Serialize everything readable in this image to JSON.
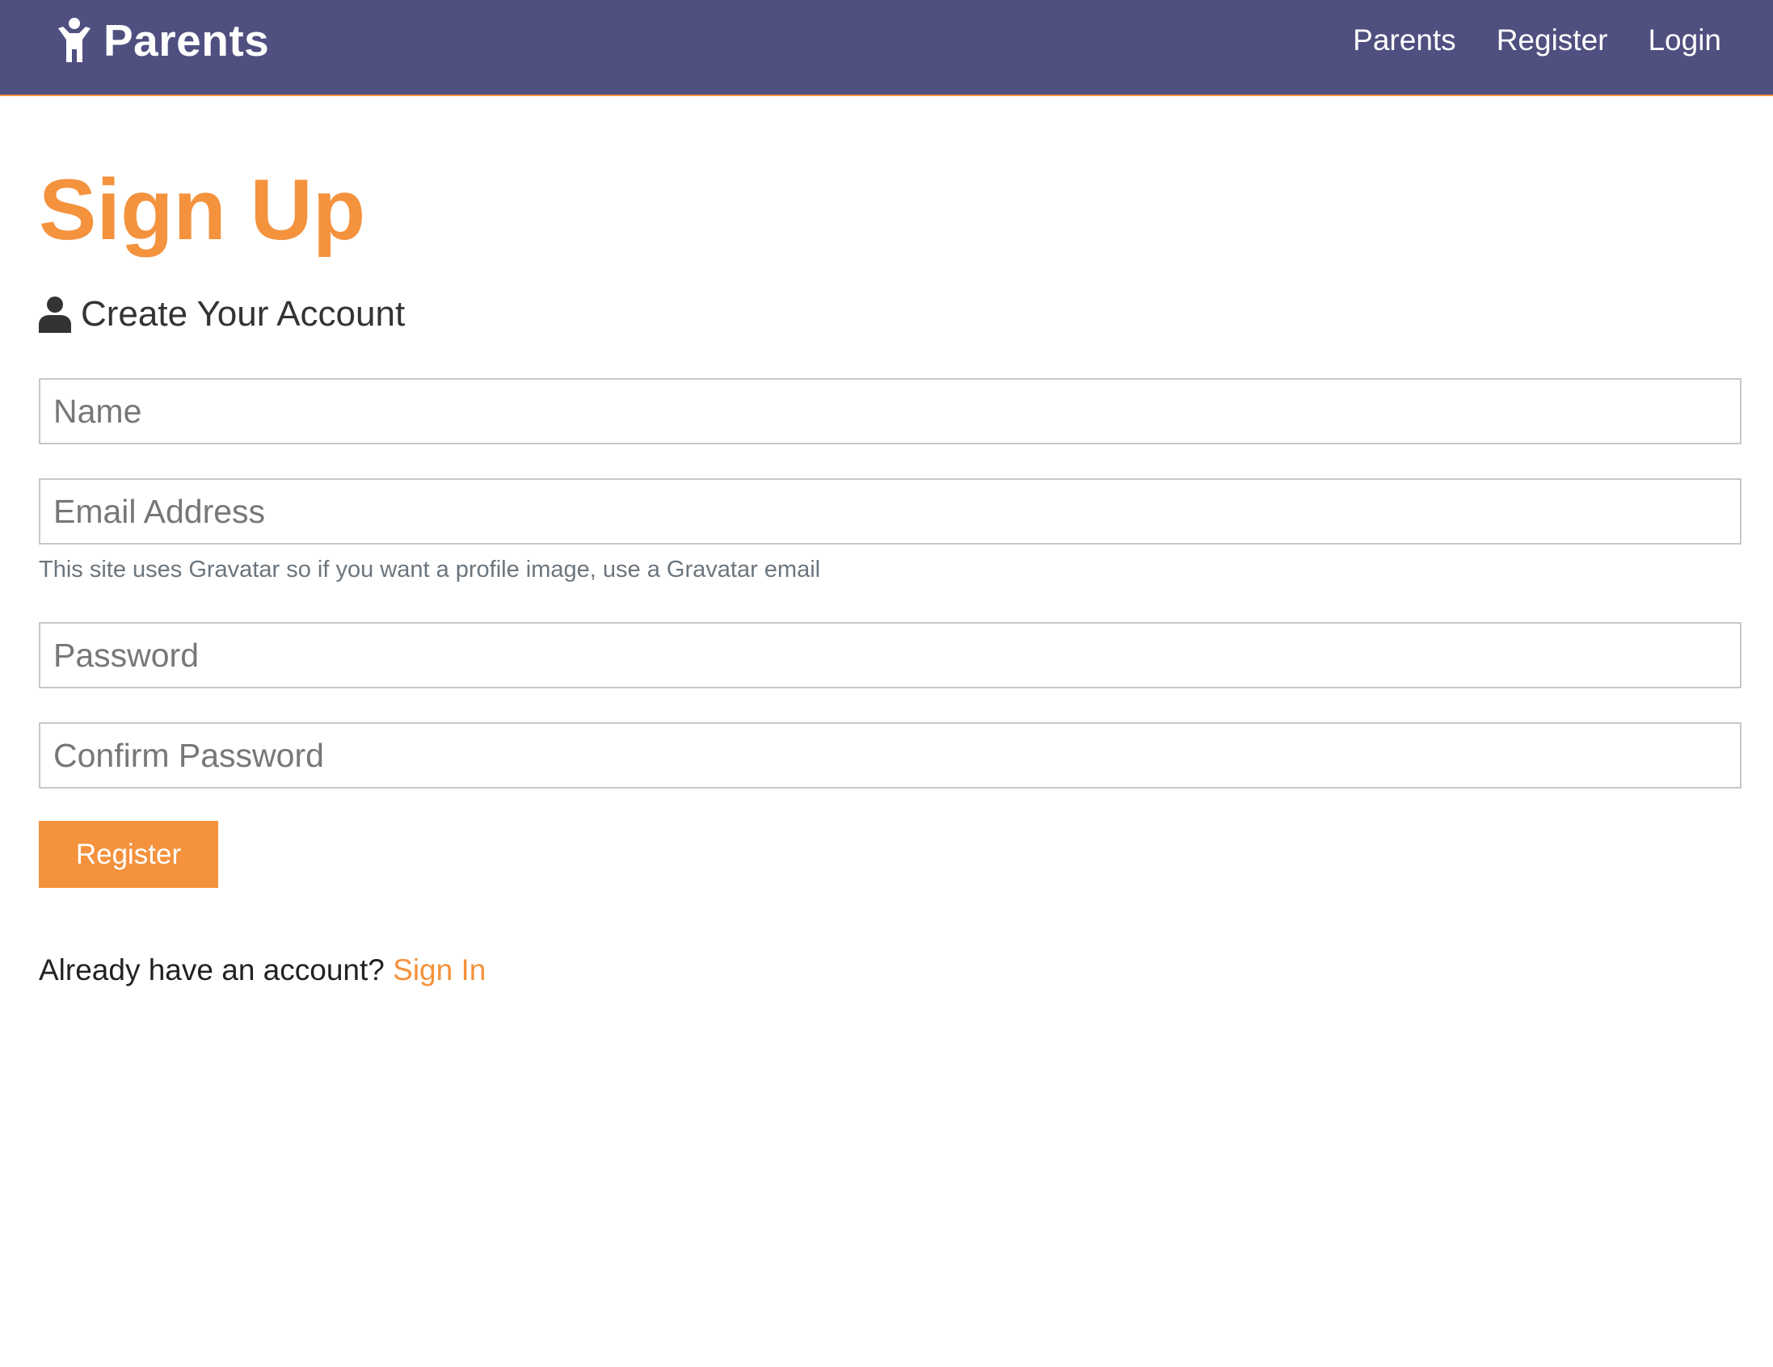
{
  "navbar": {
    "brand_label": "Parents",
    "brand_icon": "child-icon",
    "links": [
      {
        "label": "Parents"
      },
      {
        "label": "Register"
      },
      {
        "label": "Login"
      }
    ],
    "background_color": "#4f4f80",
    "accent_border_color": "#f4923d"
  },
  "main": {
    "title": "Sign Up",
    "subtitle": "Create Your Account",
    "subtitle_icon": "user-icon",
    "form": {
      "name_placeholder": "Name",
      "email_placeholder": "Email Address",
      "email_hint": "This site uses Gravatar so if you want a profile image, use a Gravatar email",
      "password_placeholder": "Password",
      "confirm_password_placeholder": "Confirm Password",
      "submit_label": "Register"
    },
    "signin_prompt": "Already have an account?",
    "signin_link": "Sign In"
  },
  "colors": {
    "accent": "#f4923d",
    "text": "#333333",
    "muted": "#6c757d"
  }
}
